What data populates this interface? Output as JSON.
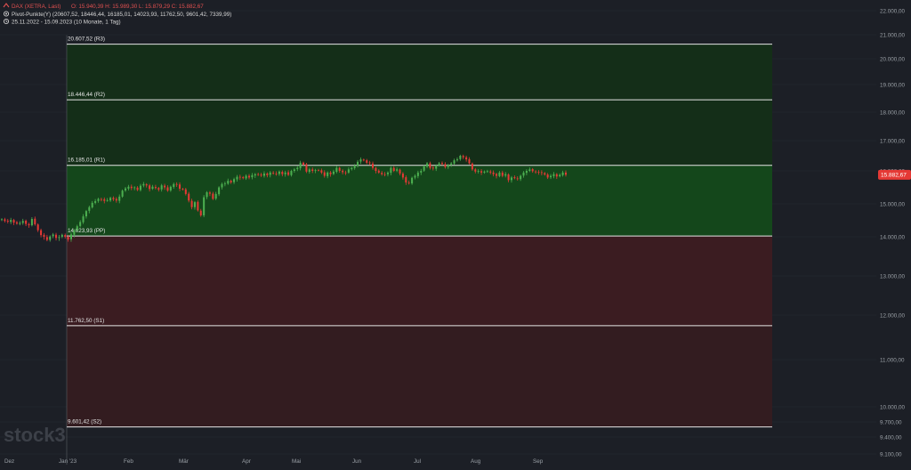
{
  "header": {
    "instrument_label": "DAX (XETRA, Last)",
    "ohlc_text": "O: 15.940,39  H: 15.989,30  L: 15.879,29  C: 15.882,67",
    "indicator_text": "Pivot-Punkte(Y)  (20607,52, 18446,44, 16185,01, 14023,93, 11762,50, 9601,42, 7339,99)",
    "range_text": "25.11.2022 - 15.09.2023  (10 Monate, 1 Tag)"
  },
  "last_price_label": "15.882,67",
  "watermark": "stock3",
  "colors": {
    "background": "#1c1f26",
    "gridline": "#262a32",
    "up": "#4caf50",
    "down": "#e53935",
    "support_zone": "#3a1e22",
    "resistance_zone": "#153a1c",
    "pivot_line": "#e6e6e6",
    "last_price_badge": "#e53935",
    "header_red": "#e05050",
    "text_muted": "#9aa0a6"
  },
  "chart_data": {
    "type": "candlestick",
    "title": "DAX (XETRA, Last)",
    "xlabel": "",
    "ylabel": "",
    "ylim": [
      9100,
      22400
    ],
    "y_ticks": [
      {
        "value": 22000,
        "label": "22.000,00"
      },
      {
        "value": 21000,
        "label": "21.000,00"
      },
      {
        "value": 20000,
        "label": "20.000,00"
      },
      {
        "value": 19000,
        "label": "19.000,00"
      },
      {
        "value": 18000,
        "label": "18.000,00"
      },
      {
        "value": 17000,
        "label": "17.000,00"
      },
      {
        "value": 16000,
        "label": "16.000,00"
      },
      {
        "value": 15000,
        "label": "15.000,00"
      },
      {
        "value": 14000,
        "label": "14.000,00"
      },
      {
        "value": 13000,
        "label": "13.000,00"
      },
      {
        "value": 12000,
        "label": "12.000,00"
      },
      {
        "value": 11000,
        "label": "11.000,00"
      },
      {
        "value": 10000,
        "label": "10.000,00"
      },
      {
        "value": 9700,
        "label": "9.700,00"
      },
      {
        "value": 9400,
        "label": "9.400,00"
      },
      {
        "value": 9100,
        "label": "9.100,00"
      }
    ],
    "x_ticks": [
      "Dez",
      "Jan '23",
      "Feb",
      "Mär",
      "Apr",
      "Mai",
      "Jun",
      "Jul",
      "Aug",
      "Sep"
    ],
    "pivot_levels": [
      {
        "name": "R3",
        "value": 20607.52,
        "label": "20.607,52 (R3)"
      },
      {
        "name": "R2",
        "value": 18446.44,
        "label": "18.446,44 (R2)"
      },
      {
        "name": "R1",
        "value": 16185.01,
        "label": "16.185,01 (R1)"
      },
      {
        "name": "PP",
        "value": 14023.93,
        "label": "14.023,93 (PP)"
      },
      {
        "name": "S1",
        "value": 11762.5,
        "label": "11.762,50 (S1)"
      },
      {
        "name": "S2",
        "value": 9601.42,
        "label": "9.601,42 (S2)"
      }
    ],
    "closes": [
      14530,
      14480,
      14460,
      14510,
      14430,
      14400,
      14420,
      14480,
      14390,
      14350,
      14540,
      14380,
      14200,
      14050,
      14000,
      13920,
      14010,
      14070,
      13970,
      13990,
      14060,
      14000,
      13930,
      14070,
      14200,
      14320,
      14450,
      14620,
      14780,
      14900,
      15030,
      15080,
      15150,
      15140,
      15090,
      15110,
      15180,
      15140,
      15100,
      15220,
      15400,
      15470,
      15520,
      15480,
      15500,
      15420,
      15550,
      15600,
      15560,
      15450,
      15520,
      15480,
      15430,
      15560,
      15500,
      15400,
      15520,
      15600,
      15580,
      15460,
      15440,
      15300,
      15100,
      14900,
      15050,
      14800,
      14650,
      15200,
      15350,
      15310,
      15150,
      15300,
      15500,
      15600,
      15620,
      15700,
      15650,
      15750,
      15820,
      15800,
      15780,
      15850,
      15800,
      15870,
      15900,
      15880,
      15860,
      15920,
      15870,
      15950,
      15920,
      15900,
      15980,
      15900,
      15950,
      15880,
      16000,
      16050,
      16100,
      16270,
      16210,
      15980,
      16050,
      16000,
      16030,
      16020,
      15950,
      15850,
      15950,
      15900,
      15980,
      16100,
      16000,
      15960,
      15950,
      16050,
      16100,
      16180,
      16300,
      16380,
      16350,
      16270,
      16250,
      16100,
      16000,
      15950,
      15900,
      15890,
      15950,
      16100,
      16000,
      16050,
      15920,
      15800,
      15650,
      15620,
      15790,
      15850,
      15950,
      16000,
      16150,
      16250,
      16100,
      16080,
      16180,
      16250,
      16230,
      16130,
      16200,
      16250,
      16350,
      16380,
      16500,
      16450,
      16380,
      16250,
      16050,
      15980,
      16000,
      15950,
      15980,
      15990,
      15950,
      15900,
      15850,
      15950,
      15850,
      15900,
      15720,
      15800,
      15780,
      15750,
      15850,
      15950,
      16000,
      16050,
      15990,
      15970,
      15950,
      15940,
      15890,
      15800,
      15850,
      15900,
      15830,
      15880,
      15950,
      15882.67
    ]
  }
}
